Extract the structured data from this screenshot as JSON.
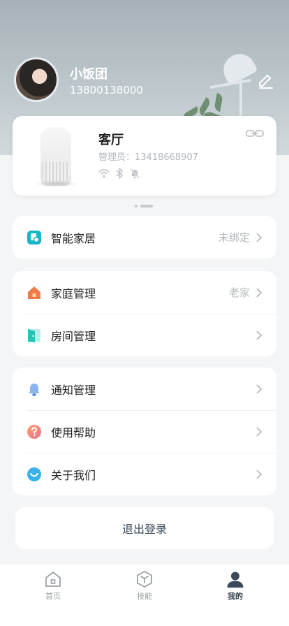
{
  "profile": {
    "name": "小饭团",
    "phone": "13800138000"
  },
  "device": {
    "room": "客厅",
    "admin": "管理员：13418668907"
  },
  "groups": {
    "smart_home": {
      "label": "智能家居",
      "value": "未绑定",
      "icon": "smart-home-icon",
      "icon_color": "#18b4c7"
    },
    "home": {
      "label": "家庭管理",
      "value": "老家",
      "icon": "house-icon",
      "icon_color": "#f07a4a"
    },
    "room": {
      "label": "房间管理",
      "value": "",
      "icon": "door-icon",
      "icon_color": "#24c3b5"
    },
    "notify": {
      "label": "通知管理",
      "value": "",
      "icon": "bell-icon",
      "icon_color": "#8ab4f0"
    },
    "help": {
      "label": "使用帮助",
      "value": "",
      "icon": "help-icon",
      "icon_color": "#f38c8c"
    },
    "about": {
      "label": "关于我们",
      "value": "",
      "icon": "smile-icon",
      "icon_color": "#3ab1ea"
    }
  },
  "logout_label": "退出登录",
  "tabbar": {
    "items": [
      {
        "label": "首页",
        "icon": "home-icon",
        "active": false
      },
      {
        "label": "技能",
        "icon": "cube-icon",
        "active": false
      },
      {
        "label": "我的",
        "icon": "person-icon",
        "active": true
      }
    ]
  },
  "colors": {
    "accent_dark": "#2f3b47",
    "muted": "#b6b9be"
  }
}
